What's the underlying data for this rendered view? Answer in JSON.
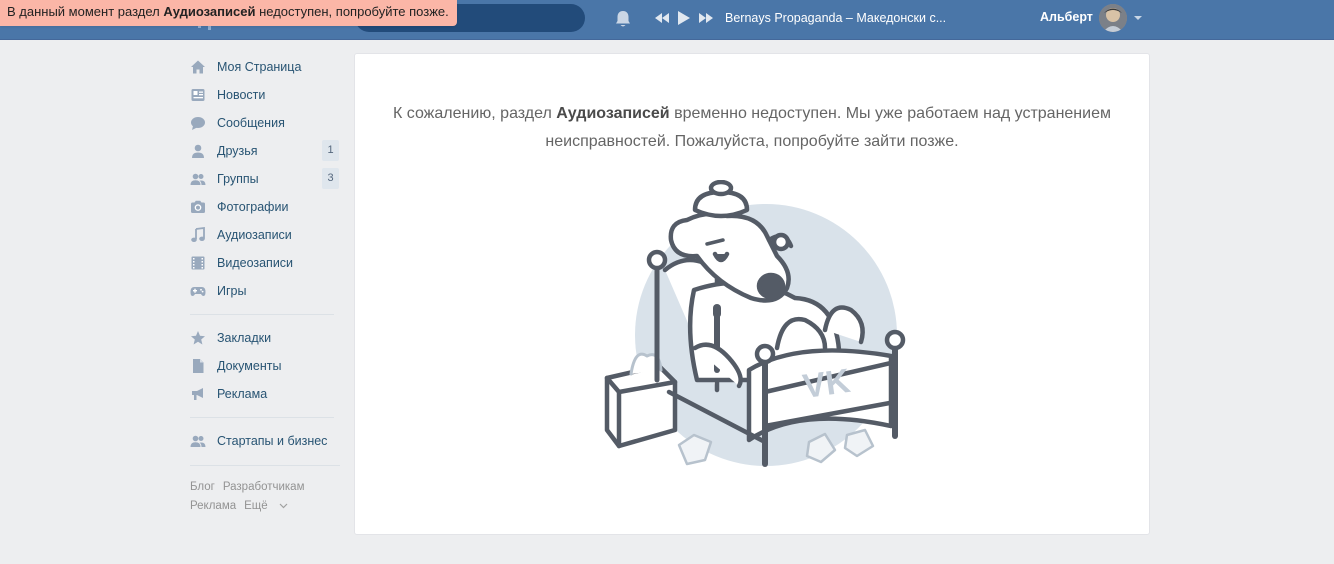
{
  "toast": {
    "prefix": "В данный момент раздел ",
    "bold": "Аудиозаписей",
    "suffix": " недоступен, попробуйте позже."
  },
  "header": {
    "track": "Bernays Propaganda – Македонски с...",
    "user_name": "Альберт",
    "icons": [
      "bell-icon",
      "prev-track-icon",
      "play-icon",
      "next-track-icon",
      "avatar",
      "chevron-down-icon"
    ]
  },
  "sidebar": {
    "items": [
      {
        "label": "Моя Страница",
        "icon": "home-icon"
      },
      {
        "label": "Новости",
        "icon": "news-icon"
      },
      {
        "label": "Сообщения",
        "icon": "messages-icon"
      },
      {
        "label": "Друзья",
        "icon": "friends-icon",
        "badge": "1"
      },
      {
        "label": "Группы",
        "icon": "groups-icon",
        "badge": "3"
      },
      {
        "label": "Фотографии",
        "icon": "camera-icon"
      },
      {
        "label": "Аудиозаписи",
        "icon": "music-icon"
      },
      {
        "label": "Видеозаписи",
        "icon": "video-icon"
      },
      {
        "label": "Игры",
        "icon": "gamepad-icon"
      }
    ],
    "items2": [
      {
        "label": "Закладки",
        "icon": "star-icon"
      },
      {
        "label": "Документы",
        "icon": "document-icon"
      },
      {
        "label": "Реклама",
        "icon": "megaphone-icon"
      }
    ],
    "items3": [
      {
        "label": "Стартапы и бизнес",
        "icon": "groups-icon"
      }
    ],
    "footer": [
      "Блог",
      "Разработчикам",
      "Реклама",
      "Ещё"
    ]
  },
  "main": {
    "message_prefix": "К сожалению, раздел ",
    "message_bold": "Аудиозаписей",
    "message_suffix": " временно недоступен. Мы уже работаем над устранением неисправностей. Пожалуйста, попробуйте зайти позже."
  },
  "colors": {
    "header": "#4a76a8",
    "toast": "#fbb6a7",
    "link": "#285473",
    "icon": "#99a9bd",
    "background": "#edeef0"
  }
}
